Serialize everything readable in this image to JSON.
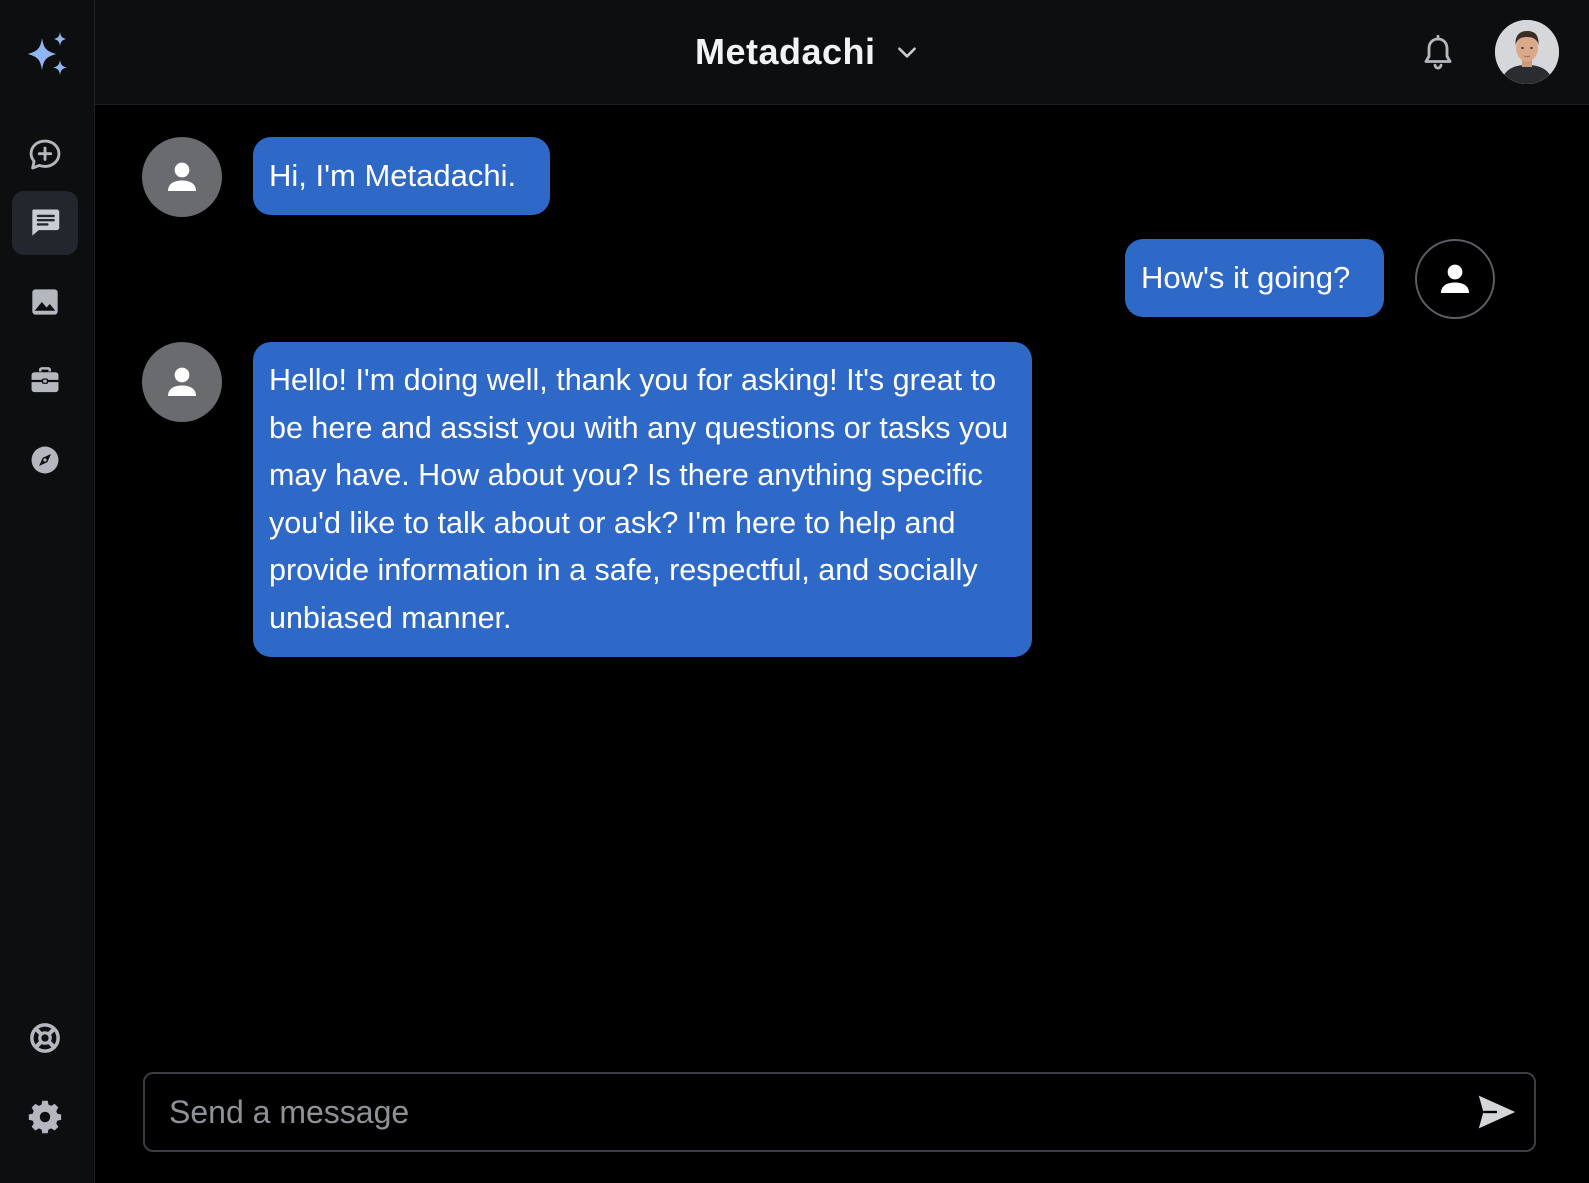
{
  "app": {
    "accent_color": "#2f69c8",
    "background_color": "#000000",
    "sidebar_color": "#0d0e10"
  },
  "header": {
    "model_name": "Metadachi"
  },
  "sidebar": {
    "items": [
      {
        "name": "new-chat",
        "icon": "chat-plus-icon",
        "active": false
      },
      {
        "name": "chats",
        "icon": "chat-bubble-icon",
        "active": true
      },
      {
        "name": "images",
        "icon": "image-icon",
        "active": false
      },
      {
        "name": "tools",
        "icon": "briefcase-icon",
        "active": false
      },
      {
        "name": "explore",
        "icon": "compass-icon",
        "active": false
      }
    ],
    "bottom_items": [
      {
        "name": "help",
        "icon": "lifebuoy-icon"
      },
      {
        "name": "settings",
        "icon": "gear-icon"
      }
    ]
  },
  "messages": [
    {
      "role": "assistant",
      "text": "Hi, I'm Metadachi."
    },
    {
      "role": "user",
      "text": "How's it going?"
    },
    {
      "role": "assistant",
      "text": "Hello! I'm doing well, thank you for asking! It's great to be here and assist you with any questions or tasks you may have. How about you? Is there anything specific you'd like to talk about or ask? I'm here to help and provide information in a safe, respectful, and socially unbiased manner."
    }
  ],
  "composer": {
    "placeholder": "Send a message",
    "value": ""
  }
}
